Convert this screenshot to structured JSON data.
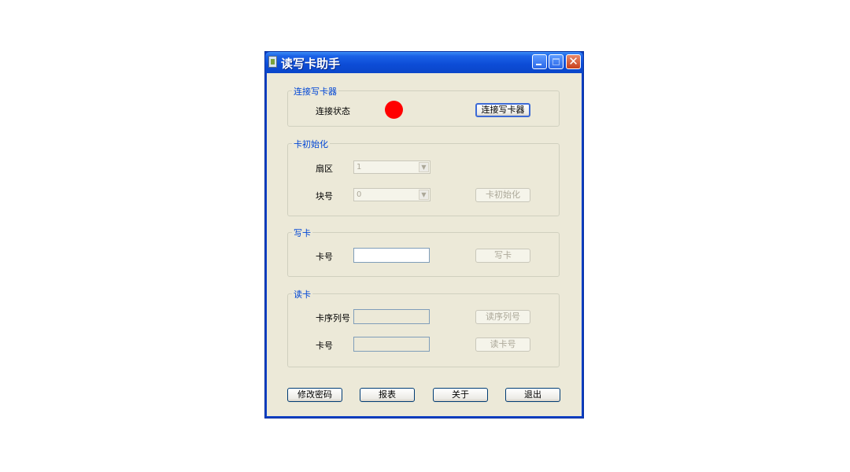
{
  "window": {
    "title": "读写卡助手"
  },
  "groups": {
    "connect": {
      "title": "连接写卡器",
      "status_label": "连接状态",
      "connect_button": "连接写卡器",
      "status_color": "#ff0000"
    },
    "init": {
      "title": "卡初始化",
      "sector_label": "扇区",
      "sector_value": "1",
      "block_label": "块号",
      "block_value": "0",
      "init_button": "卡初始化"
    },
    "write": {
      "title": "写卡",
      "card_no_label": "卡号",
      "card_no_value": "",
      "write_button": "写卡"
    },
    "read": {
      "title": "读卡",
      "serial_label": "卡序列号",
      "serial_value": "",
      "read_serial_button": "读序列号",
      "card_no_label": "卡号",
      "card_no_value": "",
      "read_card_button": "读卡号"
    }
  },
  "bottom": {
    "change_password": "修改密码",
    "report": "报表",
    "about": "关于",
    "exit": "退出"
  }
}
